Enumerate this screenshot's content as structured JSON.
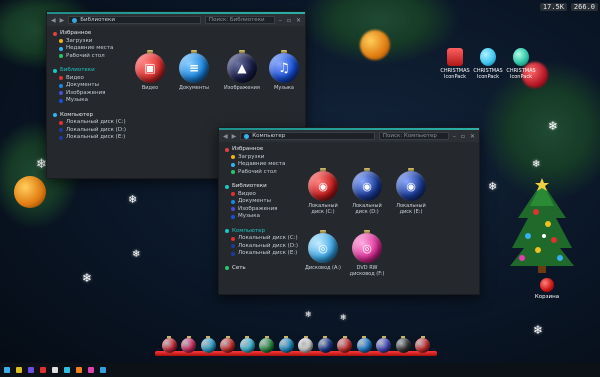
{
  "tray": {
    "download_speed": "17.5K",
    "upload_speed": "266.0"
  },
  "desktop_icons": [
    {
      "label": "CHRISTMAS IconPack",
      "color": "#e04545",
      "icon": "card-icon"
    },
    {
      "label": "CHRISTMAS IconPack",
      "color": "#3fc8f0",
      "icon": "bauble-icon"
    },
    {
      "label": "CHRISTMAS IconPack",
      "color": "#2ec4a6",
      "icon": "bauble-icon"
    }
  ],
  "trash": {
    "label": "Корзина"
  },
  "window_library": {
    "address": "Библиотеки",
    "search_placeholder": "Поиск: Библиотеки",
    "sidebar": {
      "favorites": {
        "title": "Избранное",
        "items": [
          "Загрузки",
          "Недавние места",
          "Рабочий стол"
        ]
      },
      "libraries": {
        "title": "Библиотеки",
        "items": [
          "Видео",
          "Документы",
          "Изображения",
          "Музыка"
        ]
      },
      "computer": {
        "title": "Компьютер",
        "items": [
          "Локальный диск (C:)",
          "Локальный диск (D:)",
          "Локальный диск (E:)"
        ]
      }
    },
    "items": [
      {
        "label": "Видео",
        "color": "#e03030",
        "icon": "film-icon"
      },
      {
        "label": "Документы",
        "color": "#1c86e0",
        "icon": "document-icon"
      },
      {
        "label": "Изображения",
        "color": "#1a1f4a",
        "icon": "photo-icon"
      },
      {
        "label": "Музыка",
        "color": "#1850d8",
        "icon": "music-note-icon"
      }
    ]
  },
  "window_computer": {
    "address": "Компьютер",
    "search_placeholder": "Поиск: Компьютер",
    "sidebar": {
      "favorites": {
        "title": "Избранное",
        "items": [
          "Загрузки",
          "Недавние места",
          "Рабочий стол"
        ]
      },
      "libraries": {
        "title": "Библиотеки",
        "items": [
          "Видео",
          "Документы",
          "Изображения",
          "Музыка"
        ]
      },
      "computer": {
        "title": "Компьютер",
        "items": [
          "Локальный диск (C:)",
          "Локальный диск (D:)",
          "Локальный диск (E:)"
        ]
      },
      "network": {
        "title": "Сеть"
      }
    },
    "drives": [
      {
        "label": "Локальный диск (C:)",
        "color": "#c81e1e"
      },
      {
        "label": "Локальный диск (D:)",
        "color": "#1c3c9a"
      },
      {
        "label": "Локальный диск (E:)",
        "color": "#1c3c9a"
      },
      {
        "label": "Дисковод (A:)",
        "color": "#3aa8e8"
      },
      {
        "label": "DVD RW дисковод (F:)",
        "color": "#e0309a"
      }
    ]
  },
  "dock_colors": [
    "#e03040",
    "#e0306a",
    "#30b0e0",
    "#e03030",
    "#3ec8e8",
    "#2a9a4a",
    "#1c9ad8",
    "#e8e8e8",
    "#1a3c9a",
    "#e03030",
    "#1c86e0",
    "#4a4fd0",
    "#3a3a3a",
    "#e03030"
  ],
  "taskbar_colors": [
    "#3ab0f0",
    "#e0c020",
    "#6a4fe0",
    "#e03030",
    "#e0e0e0",
    "#30c0e0",
    "#f08020",
    "#e040b0",
    "#30a0e0"
  ]
}
